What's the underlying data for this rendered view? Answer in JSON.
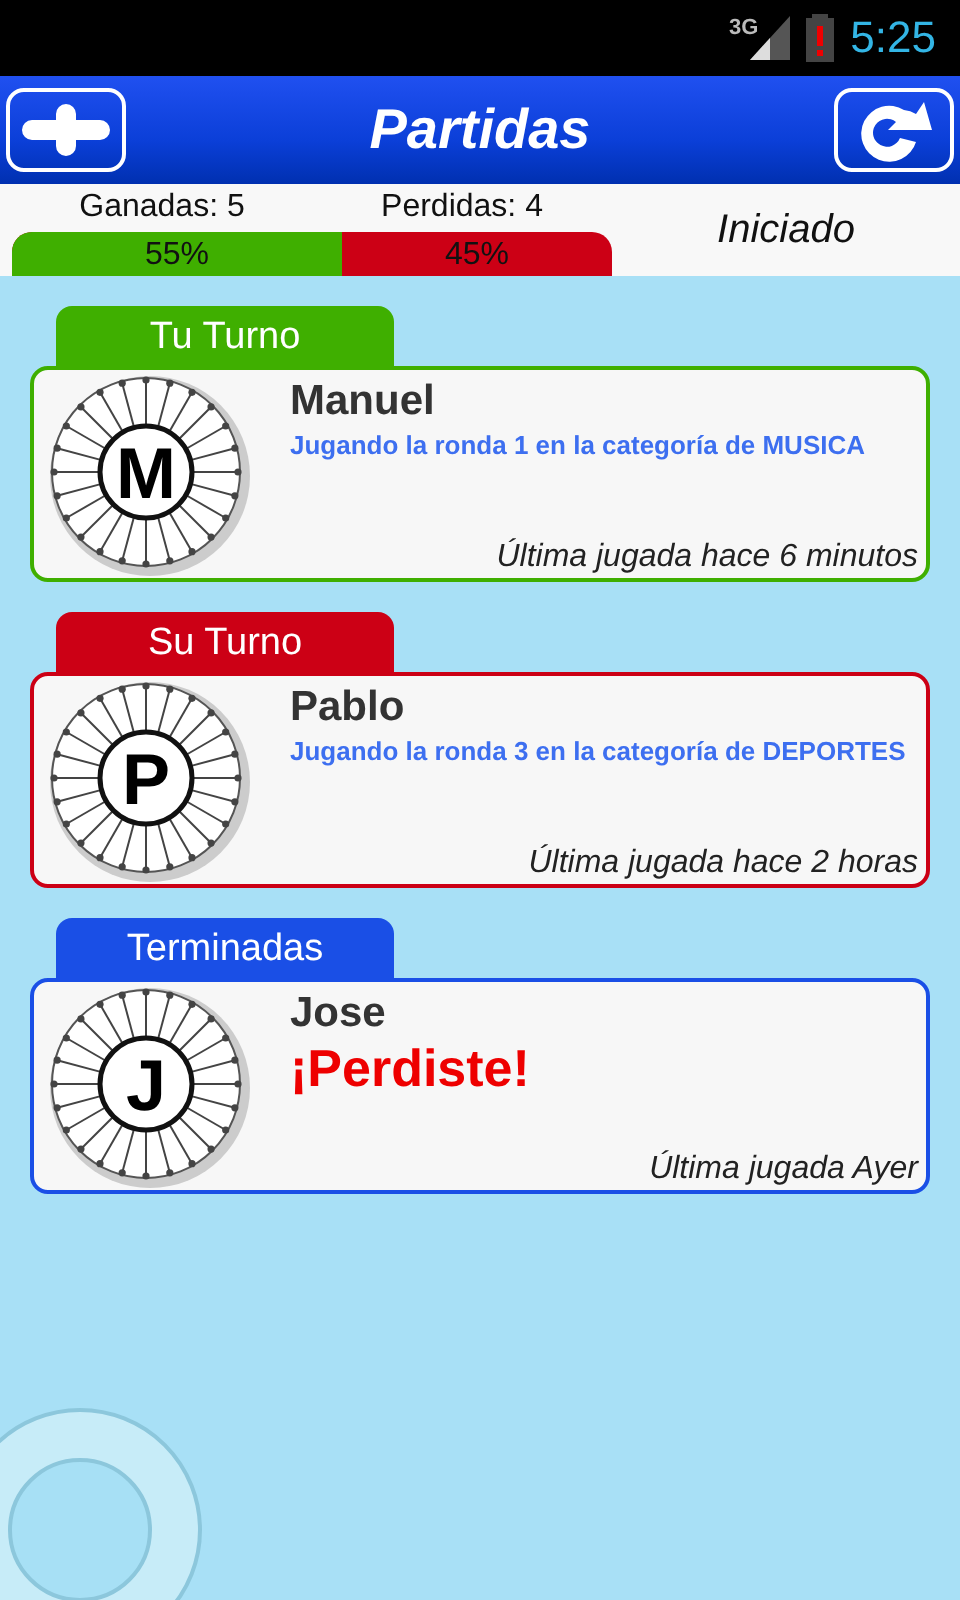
{
  "status_bar": {
    "network": "3G",
    "time": "5:25"
  },
  "header": {
    "title": "Partidas"
  },
  "stats": {
    "won": "Ganadas: 5",
    "lost": "Perdidas: 4",
    "level": 0.55,
    "won_percent": "55%",
    "lost_percent": "45%",
    "state": "Iniciado"
  },
  "sections": [
    {
      "title": "Tu Turno",
      "color": "#3faf00",
      "games": [
        {
          "letter": "M",
          "player": "Manuel",
          "kind": "info",
          "message": "Jugando la ronda 1 en la categoría de MUSICA",
          "last_play": "Última jugada hace 6 minutos"
        }
      ]
    },
    {
      "title": "Su Turno",
      "color": "#cc0015",
      "games": [
        {
          "letter": "P",
          "player": "Pablo",
          "kind": "info",
          "message": "Jugando la ronda 3 en la categoría de DEPORTES",
          "last_play": "Última jugada hace 2 horas"
        }
      ]
    },
    {
      "title": "Terminadas",
      "color": "#1a4fe6",
      "games": [
        {
          "letter": "J",
          "player": "Jose",
          "kind": "result",
          "message": "¡Perdiste!",
          "last_play": "Última jugada Ayer"
        }
      ]
    }
  ]
}
